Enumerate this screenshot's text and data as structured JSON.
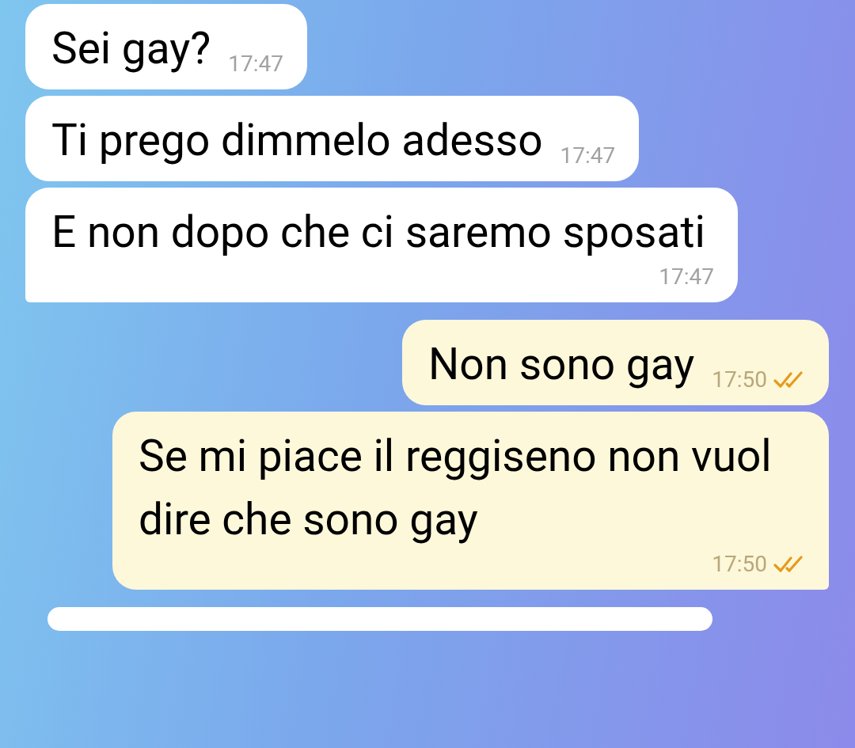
{
  "messages": [
    {
      "kind": "incoming",
      "text": "Sei gay?",
      "time": "17:47",
      "tail": false
    },
    {
      "kind": "incoming",
      "text": "Ti prego dimmelo adesso",
      "time": "17:47",
      "tail": false
    },
    {
      "kind": "incoming",
      "text": "E non dopo che ci saremo sposati",
      "time": "17:47",
      "tail": true
    },
    {
      "kind": "outgoing",
      "text": "Non sono gay",
      "time": "17:50",
      "read": true,
      "tail": false
    },
    {
      "kind": "outgoing",
      "text": "Se mi piace il reggiseno non vuol dire che sono gay",
      "time": "17:50",
      "read": true,
      "tail": true
    },
    {
      "kind": "partial"
    }
  ]
}
